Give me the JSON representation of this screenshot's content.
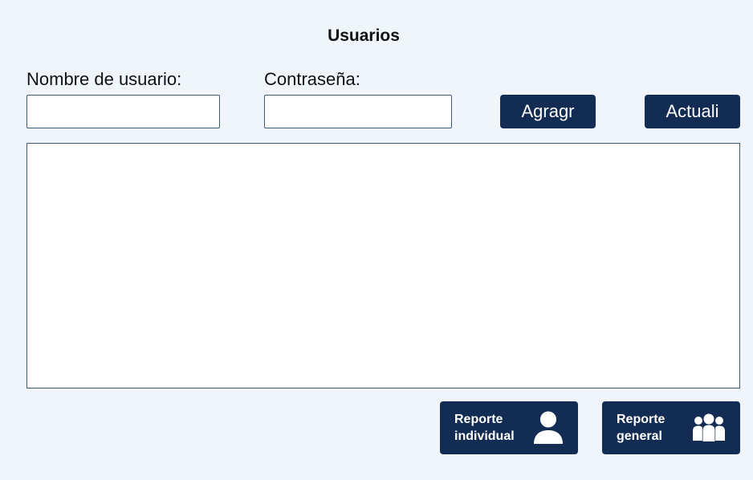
{
  "page": {
    "title": "Usuarios"
  },
  "form": {
    "username_label": "Nombre de usuario:",
    "username_value": "",
    "password_label": "Contraseña:",
    "password_value": ""
  },
  "actions": {
    "add_label": "Agragr",
    "update_label": "Actuali"
  },
  "users_list": {
    "items": []
  },
  "reports": {
    "individual_line1": "Reporte",
    "individual_line2": "individual",
    "individual_icon": "person-icon",
    "general_line1": "Reporte",
    "general_line2": "general",
    "general_icon": "group-icon"
  },
  "colors": {
    "background": "#f0f4fb",
    "button": "#132c54",
    "border": "#3a5a80"
  }
}
